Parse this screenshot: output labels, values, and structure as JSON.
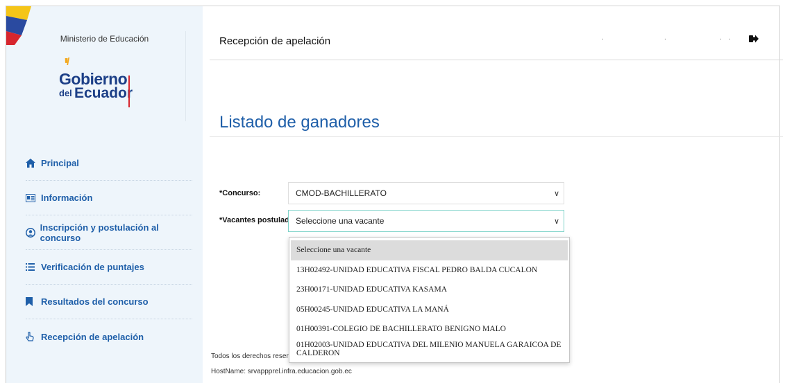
{
  "sidebar": {
    "ministry": "Ministerio de Educación",
    "logo": {
      "line1": "Gobierno",
      "line2_small": "del",
      "line2": "Ecuador"
    },
    "items": [
      {
        "label": "Principal",
        "icon": "home-icon"
      },
      {
        "label": "Información",
        "icon": "id-card-icon"
      },
      {
        "label": "Inscripción y postulación al concurso",
        "icon": "user-circle-icon"
      },
      {
        "label": "Verificación de puntajes",
        "icon": "list-icon"
      },
      {
        "label": "Resultados del concurso",
        "icon": "bookmark-icon"
      },
      {
        "label": "Recepción de apelación",
        "icon": "hand-pointer-icon"
      }
    ]
  },
  "header": {
    "title": "Recepción de apelación",
    "logout_icon": "sign-out-icon"
  },
  "main": {
    "section_title": "Listado de ganadores",
    "concurso_label": "*Concurso:",
    "concurso_value": "CMOD-BACHILLERATO",
    "vacantes_label": "*Vacantes postuladas:",
    "vacantes_value": "Seleccione una vacante",
    "vacantes_options": [
      "Seleccione una vacante",
      "13H02492-UNIDAD EDUCATIVA FISCAL PEDRO BALDA CUCALON",
      "23H00171-UNIDAD EDUCATIVA KASAMA",
      "05H00245-UNIDAD EDUCATIVA LA MANÁ",
      "01H00391-COLEGIO DE BACHILLERATO BENIGNO MALO",
      "01H02003-UNIDAD EDUCATIVA DEL MILENIO MANUELA GARAICOA DE CALDERON"
    ]
  },
  "footer": {
    "rights": "Todos los derechos reserva",
    "hostname": "HostName: srvappprel.infra.educacion.gob.ec"
  },
  "colors": {
    "accent": "#1f5fa9",
    "sidebar_bg": "#eef5fb",
    "focus_border": "#7fd3c9"
  }
}
